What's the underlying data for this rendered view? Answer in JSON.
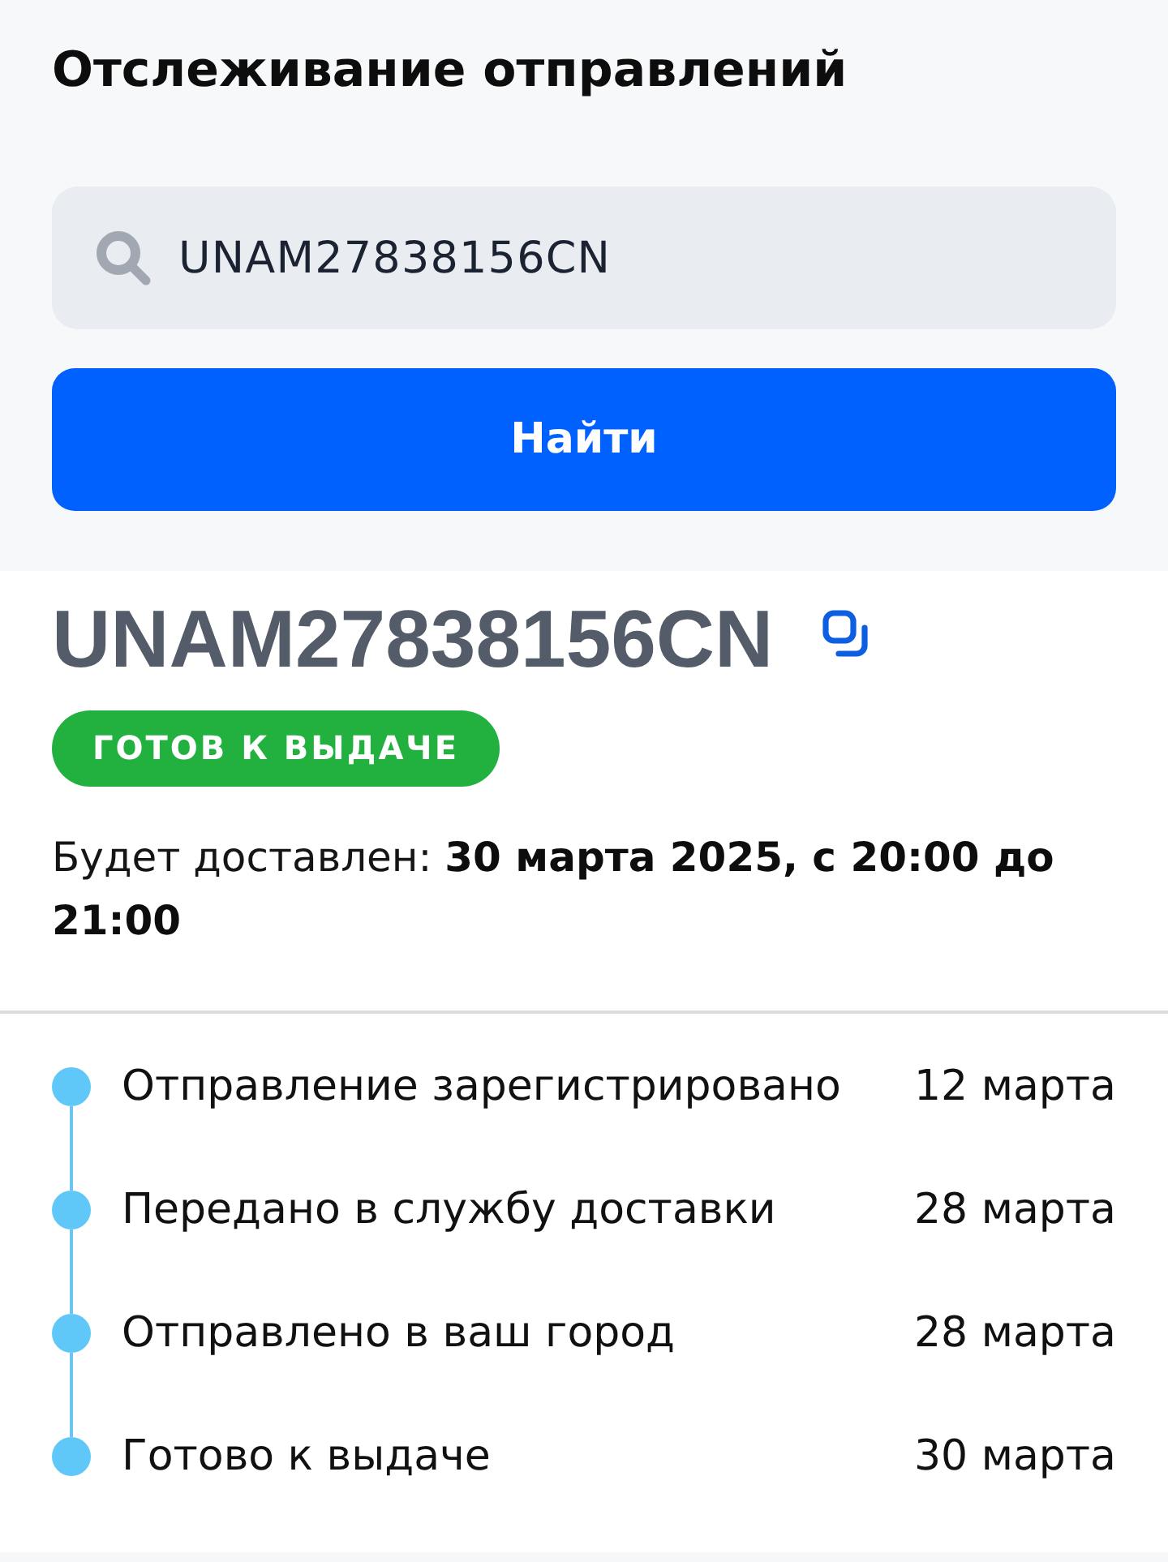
{
  "header": {
    "title": "Отслеживание отправлений"
  },
  "search": {
    "value": "UNAM27838156CN",
    "button": "Найти"
  },
  "shipment": {
    "tracking_number": "UNAM27838156CN",
    "status": "ГОТОВ К ВЫДАЧЕ",
    "delivery": "Будет доставлен: **30 марта 2025, с 20:00 до 21:00**"
  },
  "timeline": [
    {
      "label": "Отправление зарегистрировано",
      "date": "12 марта"
    },
    {
      "label": "Передано в службу доставки",
      "date": "28 марта"
    },
    {
      "label": "Отправлено в ваш город",
      "date": "28 марта"
    },
    {
      "label": "Готово к выдаче",
      "date": "30 марта"
    }
  ]
}
